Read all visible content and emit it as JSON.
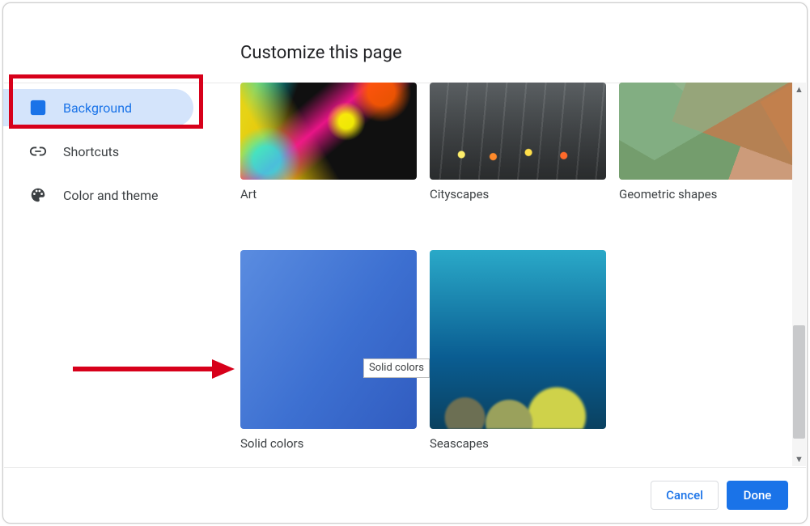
{
  "title": "Customize this page",
  "sidebar": {
    "items": [
      {
        "label": "Background",
        "icon": "image-frame-icon",
        "active": true
      },
      {
        "label": "Shortcuts",
        "icon": "link-icon",
        "active": false
      },
      {
        "label": "Color and theme",
        "icon": "palette-icon",
        "active": false
      }
    ]
  },
  "categories": {
    "row1": [
      {
        "label": "Art",
        "key": "art"
      },
      {
        "label": "Cityscapes",
        "key": "cityscapes"
      },
      {
        "label": "Geometric shapes",
        "key": "geometric-shapes"
      }
    ],
    "row2": [
      {
        "label": "Solid colors",
        "key": "solid-colors"
      },
      {
        "label": "Seascapes",
        "key": "seascapes"
      }
    ]
  },
  "tooltip": "Solid colors",
  "buttons": {
    "cancel": "Cancel",
    "done": "Done"
  },
  "annotation": {
    "highlight": "sidebar-item-background",
    "arrow_points_to": "tile-solid-colors"
  },
  "colors": {
    "accent": "#1a73e8",
    "hover_bg": "#d4e4fb",
    "annotation": "#d7001a"
  }
}
